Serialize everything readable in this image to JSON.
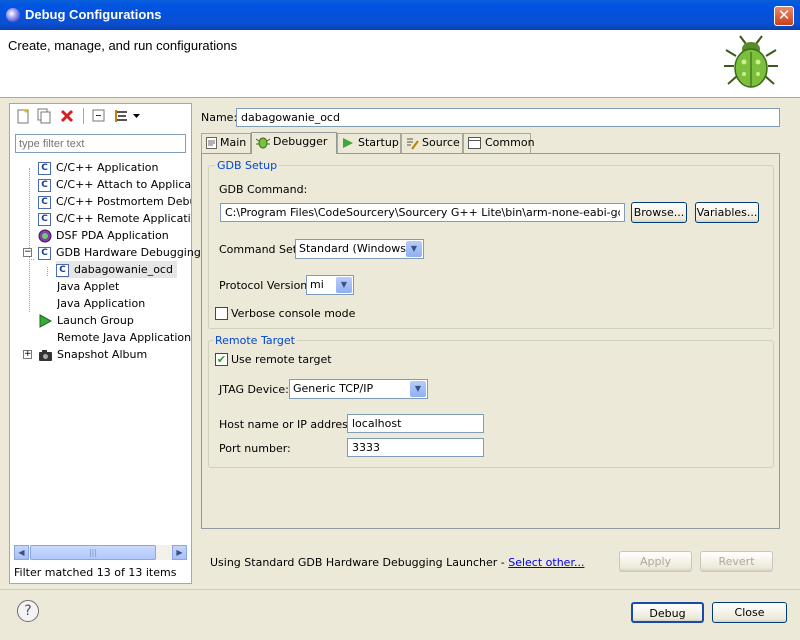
{
  "window": {
    "title": "Debug Configurations",
    "close_glyph": "✕"
  },
  "header": {
    "title": "Create, manage, and run configurations"
  },
  "left": {
    "filter_placeholder": "type filter text",
    "filter_message": "Filter matched 13 of 13 items",
    "tree": [
      {
        "label": "C/C++ Application",
        "icon": "c-config-icon"
      },
      {
        "label": "C/C++ Attach to Application",
        "icon": "c-config-icon"
      },
      {
        "label": "C/C++ Postmortem Debugger",
        "icon": "c-config-icon"
      },
      {
        "label": "C/C++ Remote Application",
        "icon": "c-config-icon"
      },
      {
        "label": "DSF PDA Application",
        "icon": "dsf-icon"
      },
      {
        "label": "GDB Hardware Debugging",
        "icon": "c-config-icon"
      },
      {
        "label": "dabagowanie_ocd",
        "icon": "c-config-icon"
      },
      {
        "label": "Java Applet",
        "icon": "none"
      },
      {
        "label": "Java Application",
        "icon": "none"
      },
      {
        "label": "Launch Group",
        "icon": "launch-group-icon"
      },
      {
        "label": "Remote Java Application",
        "icon": "none"
      },
      {
        "label": "Snapshot Album",
        "icon": "camera-icon"
      }
    ]
  },
  "config": {
    "name_label": "Name:",
    "name_value": "dabagowanie_ocd",
    "tabs": [
      "Main",
      "Debugger",
      "Startup",
      "Source",
      "Common"
    ],
    "active_tab": "Debugger",
    "gdb_setup": {
      "legend": "GDB Setup",
      "command_label": "GDB Command:",
      "command_value": "C:\\Program Files\\CodeSourcery\\Sourcery G++ Lite\\bin\\arm-none-eabi-gdb.exe",
      "browse": "Browse...",
      "variables": "Variables...",
      "command_set_label": "Command Set:",
      "command_set_value": "Standard (Windows)",
      "protocol_label": "Protocol Version:",
      "protocol_value": "mi",
      "verbose_label": "Verbose console mode",
      "verbose_checked": false
    },
    "remote": {
      "legend": "Remote Target",
      "use_remote_label": "Use remote target",
      "use_remote_checked": true,
      "jtag_label": "JTAG Device:",
      "jtag_value": "Generic TCP/IP",
      "host_label": "Host name or IP address:",
      "host_value": "localhost",
      "port_label": "Port number:",
      "port_value": "3333"
    }
  },
  "footer": {
    "launcher_text": "Using Standard GDB Hardware Debugging Launcher - ",
    "select_other": "Select other...",
    "apply": "Apply",
    "revert": "Revert",
    "debug": "Debug",
    "close": "Close",
    "help_glyph": "?"
  }
}
